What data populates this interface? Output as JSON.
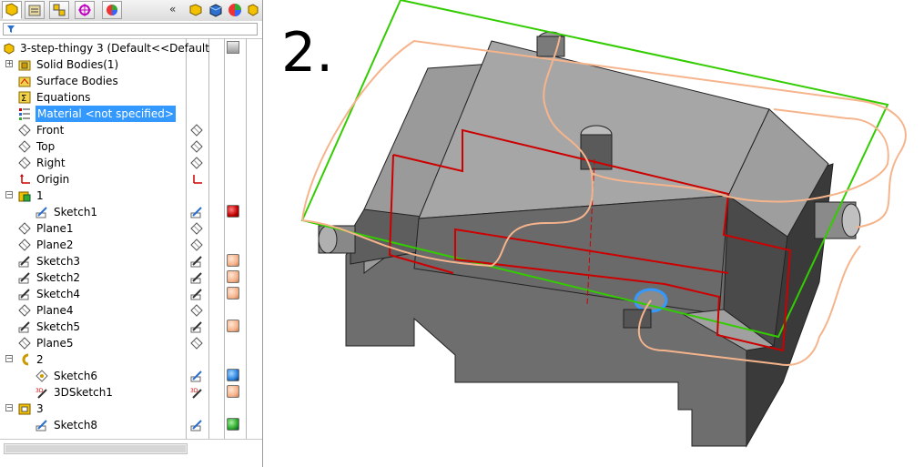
{
  "tree": {
    "root": "3-step-thingy 3  (Default<<Default",
    "items": [
      {
        "label": "Solid Bodies(1)"
      },
      {
        "label": "Surface Bodies"
      },
      {
        "label": "Equations"
      },
      {
        "label": "Material <not specified>"
      },
      {
        "label": "Front"
      },
      {
        "label": "Top"
      },
      {
        "label": "Right"
      },
      {
        "label": "Origin"
      },
      {
        "label": "1"
      },
      {
        "label": "Sketch1"
      },
      {
        "label": "Plane1"
      },
      {
        "label": "Plane2"
      },
      {
        "label": "Sketch3"
      },
      {
        "label": "Sketch2"
      },
      {
        "label": "Sketch4"
      },
      {
        "label": "Plane4"
      },
      {
        "label": "Sketch5"
      },
      {
        "label": "Plane5"
      },
      {
        "label": "2"
      },
      {
        "label": "Sketch6"
      },
      {
        "label": "3DSketch1"
      },
      {
        "label": "3"
      },
      {
        "label": "Sketch8"
      }
    ]
  },
  "viewport": {
    "step_label": "2."
  },
  "colors": {
    "selection": "#3399ff",
    "body_top": "#a6a6a6",
    "body_front": "#6e6e6e",
    "body_side": "#3c3c3c",
    "sketch_red": "#cc0000",
    "sketch_orange": "#f5b48c",
    "plane_green": "#33cc00",
    "highlight_blue": "#3399ff"
  }
}
